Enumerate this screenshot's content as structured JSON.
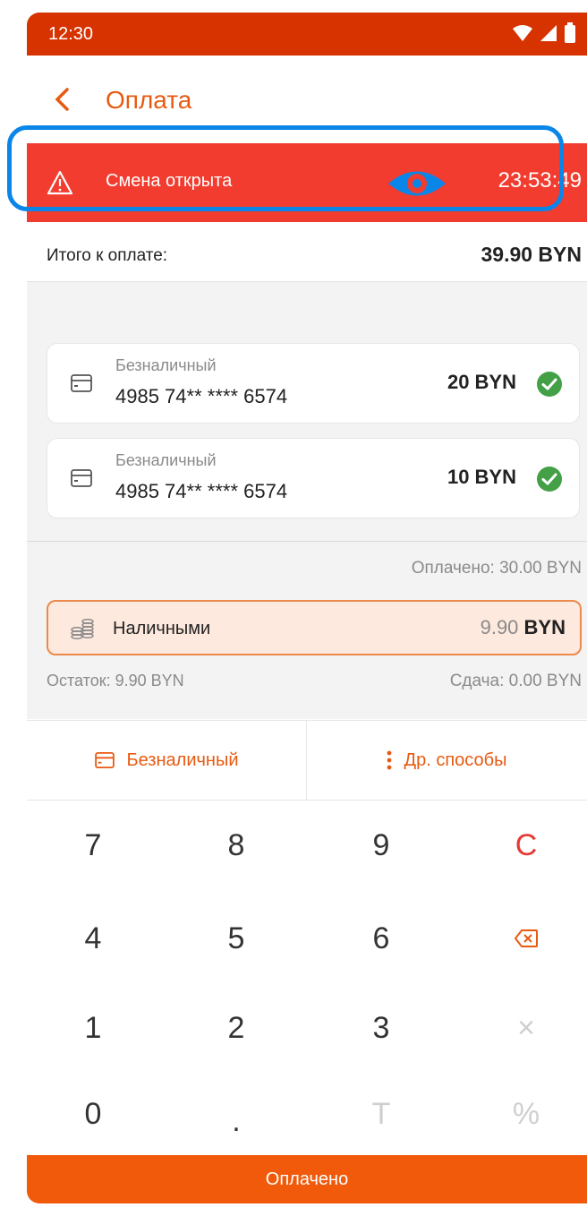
{
  "status_bar": {
    "time": "12:30"
  },
  "header": {
    "title": "Оплата"
  },
  "shift_alert": {
    "label": "Смена открыта",
    "timer": "23:53:49"
  },
  "total": {
    "label": "Итого к оплате:",
    "value": "39.90 BYN"
  },
  "payments": [
    {
      "type": "Безналичный",
      "card": "4985 74** **** 6574",
      "amount": "20 BYN",
      "status_color": "#43a047"
    },
    {
      "type": "Безналичный",
      "card": "4985 74** **** 6574",
      "amount": "10 BYN",
      "status_color": "#43a047"
    }
  ],
  "paid_summary": "Оплачено: 30.00 BYN",
  "cash": {
    "label": "Наличными",
    "amount": "9.90",
    "currency": "BYN"
  },
  "remainder": "Остаток: 9.90 BYN",
  "change": "Сдача: 0.00 BYN",
  "methods": {
    "cashless": "Безналичный",
    "other": "Др. способы"
  },
  "keypad": {
    "k7": "7",
    "k8": "8",
    "k9": "9",
    "clear": "C",
    "k4": "4",
    "k5": "5",
    "k6": "6",
    "k1": "1",
    "k2": "2",
    "k3": "3",
    "multiply": "×",
    "k0": "0",
    "dot": ".",
    "t": "T",
    "percent": "%"
  },
  "pay_button": "Оплачено",
  "colors": {
    "accent": "#e85a12",
    "alert": "#f23c2f",
    "status_bar": "#d63300",
    "highlight": "#0a86e8"
  }
}
